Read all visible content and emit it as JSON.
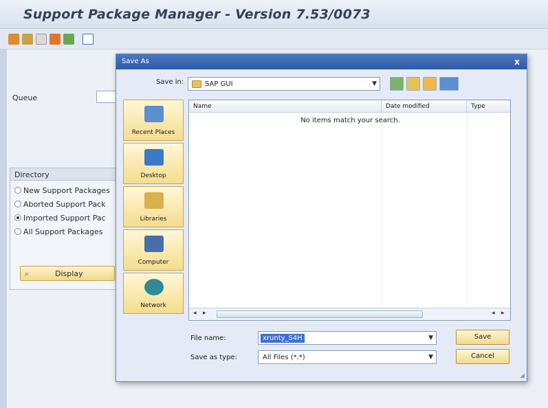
{
  "sap": {
    "title": "Support Package Manager - Version 7.53/0073",
    "queue_label": "Queue",
    "directory": {
      "heading": "Directory",
      "options": [
        {
          "label": "New Support Packages",
          "selected": false
        },
        {
          "label": "Aborted Support Pack",
          "selected": false
        },
        {
          "label": "Imported Support Pac",
          "selected": true
        },
        {
          "label": "All Support Packages",
          "selected": false
        }
      ],
      "display_label": "Display"
    },
    "toolbar_icons": [
      "settings-icon",
      "search-icon",
      "document-icon",
      "package-icon",
      "check-icon",
      "info-icon"
    ]
  },
  "dialog": {
    "title": "Save As",
    "close_glyph": "x",
    "save_in_label": "Save in:",
    "save_in_value": "SAP GUI",
    "places": [
      {
        "label": "Recent Places",
        "icon": "recent-places-icon",
        "color": "#5a8fd0"
      },
      {
        "label": "Desktop",
        "icon": "desktop-icon",
        "color": "#3a78c8"
      },
      {
        "label": "Libraries",
        "icon": "libraries-icon",
        "color": "#d9b04a"
      },
      {
        "label": "Computer",
        "icon": "computer-icon",
        "color": "#4a6fa8"
      },
      {
        "label": "Network",
        "icon": "network-icon",
        "color": "#2f8a9a"
      }
    ],
    "columns": [
      "Name",
      "Date modified",
      "Type"
    ],
    "empty_message": "No items match your search.",
    "file_name_label": "File name:",
    "file_name_value": "xrunty_S4H",
    "save_as_type_label": "Save as type:",
    "save_as_type_value": "All Files (*.*)",
    "save_label": "Save",
    "cancel_label": "Cancel"
  },
  "colors": {
    "dialog_title": "#2d5aa6",
    "button_gold": "#f2d98c",
    "selection": "#3d6fd6"
  }
}
